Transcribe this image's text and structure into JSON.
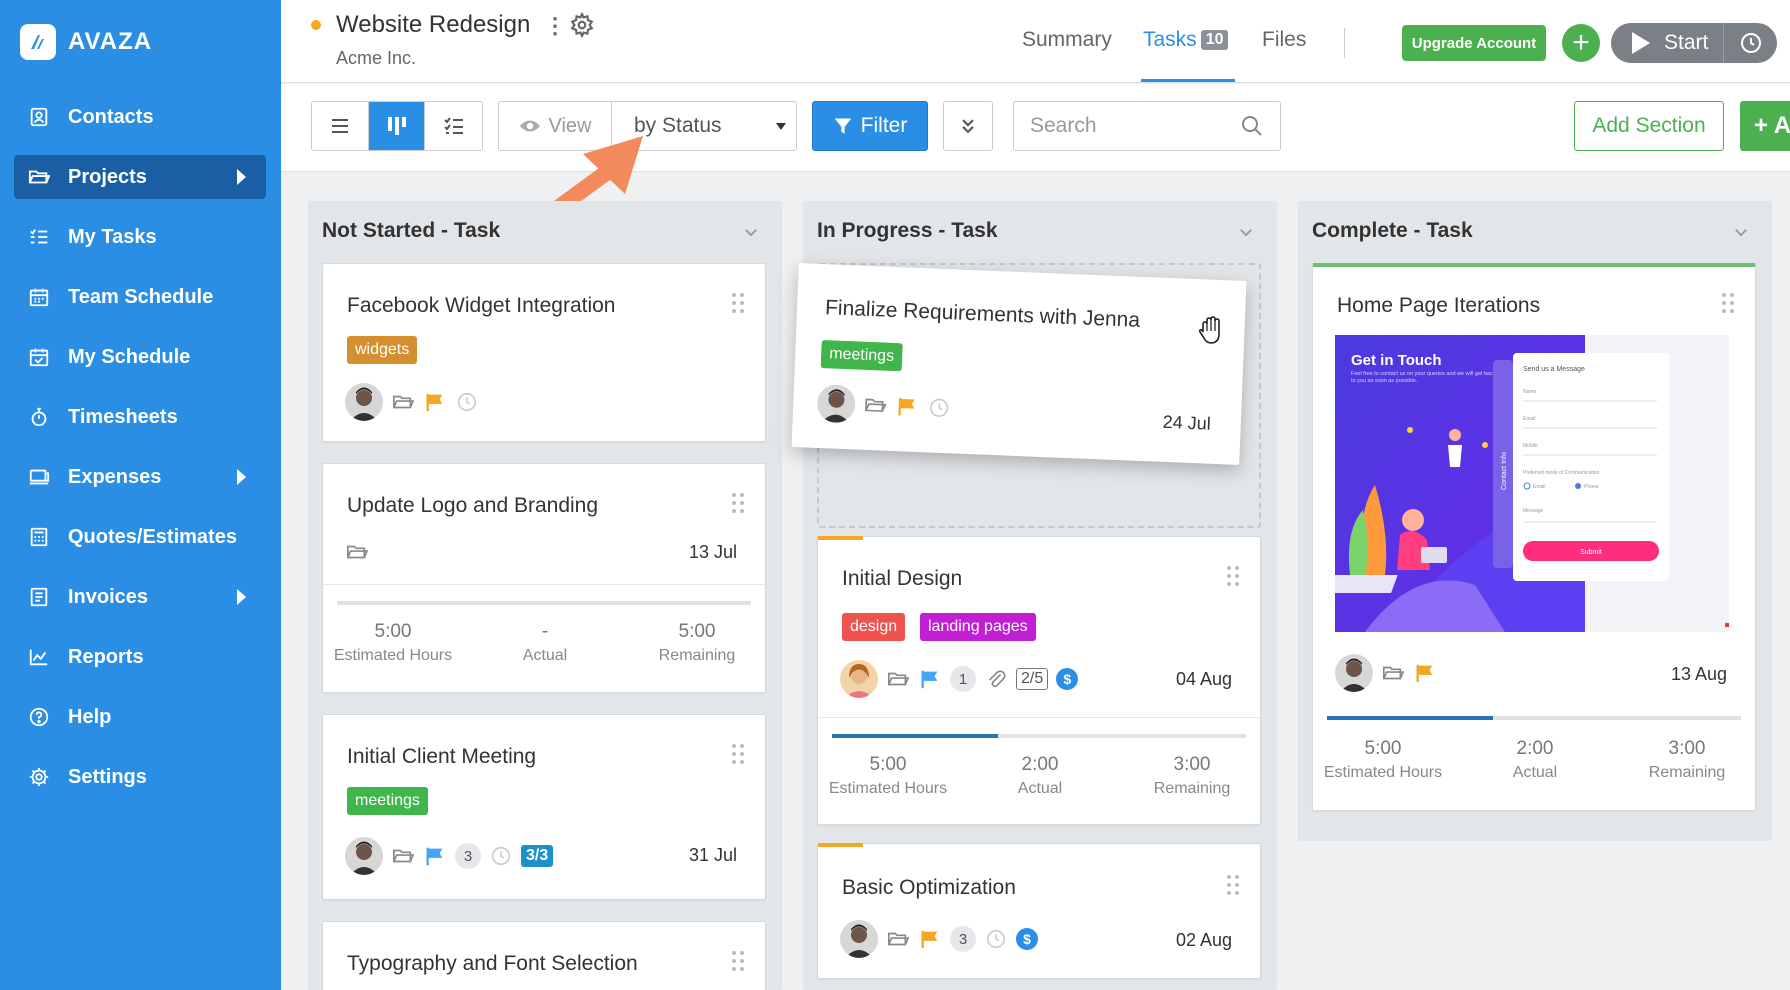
{
  "brand": {
    "name": "AVAZA",
    "logo_letter": "/"
  },
  "sidebar": {
    "items": [
      {
        "label": "Contacts",
        "icon": "contacts-icon"
      },
      {
        "label": "Projects",
        "icon": "folder-icon",
        "active": true,
        "arrow": true
      },
      {
        "label": "My Tasks",
        "icon": "tasks-icon"
      },
      {
        "label": "Team Schedule",
        "icon": "calendar-icon"
      },
      {
        "label": "My Schedule",
        "icon": "calendar-check-icon"
      },
      {
        "label": "Timesheets",
        "icon": "stopwatch-icon"
      },
      {
        "label": "Expenses",
        "icon": "expenses-icon",
        "arrow": true
      },
      {
        "label": "Quotes/Estimates",
        "icon": "calculator-icon"
      },
      {
        "label": "Invoices",
        "icon": "invoice-icon",
        "arrow": true
      },
      {
        "label": "Reports",
        "icon": "chart-icon"
      },
      {
        "label": "Help",
        "icon": "help-icon"
      },
      {
        "label": "Settings",
        "icon": "gear-icon"
      }
    ]
  },
  "header": {
    "project_title": "Website Redesign",
    "client": "Acme Inc.",
    "tabs": [
      {
        "label": "Summary"
      },
      {
        "label": "Tasks",
        "count": "10",
        "active": true
      },
      {
        "label": "Files"
      }
    ],
    "upgrade_label": "Upgrade Account",
    "start_label": "Start"
  },
  "toolbar": {
    "view_label": "View",
    "view_value": "by Status",
    "filter_label": "Filter",
    "search_placeholder": "Search",
    "add_section_label": "Add Section",
    "add_task_label": "+ A"
  },
  "colors": {
    "sidebar": "#2b8ee5",
    "sidebar_active": "#1a5fa4",
    "accent": "#2b8ee5",
    "green": "#4caf50",
    "tag_widgets": "#d4902e",
    "tag_meetings": "#3fb54a",
    "tag_design": "#ef5350",
    "tag_landing": "#c21fd4",
    "flag_orange": "#f5a623",
    "flag_blue": "#42a5f5",
    "arrow": "#f28a5c"
  },
  "columns": [
    {
      "title": "Not Started - Task",
      "cards": [
        {
          "title": "Facebook Widget Integration",
          "tag": "widgets"
        },
        {
          "title": "Update Logo and Branding",
          "due": "13 Jul",
          "estimated": "5:00",
          "actual": "-",
          "remaining": "5:00"
        },
        {
          "title": "Initial Client Meeting",
          "tag": "meetings",
          "comments": "3",
          "checklist": "3/3",
          "due": "31 Jul"
        },
        {
          "title": "Typography and Font Selection"
        }
      ]
    },
    {
      "title": "In Progress - Task",
      "dragged": {
        "title": "Finalize Requirements with Jenna",
        "tag": "meetings",
        "due": "24 Jul"
      },
      "cards": [
        {
          "title": "Initial Design",
          "tags": [
            "design",
            "landing pages"
          ],
          "comments": "1",
          "checklist": "2/5",
          "due": "04 Aug",
          "progress": 0.4,
          "estimated": "5:00",
          "actual": "2:00",
          "remaining": "3:00"
        },
        {
          "title": "Basic Optimization",
          "comments": "3",
          "due": "02 Aug"
        }
      ]
    },
    {
      "title": "Complete - Task",
      "cards": [
        {
          "title": "Home Page Iterations",
          "due": "13 Aug",
          "progress": 0.4,
          "estimated": "5:00",
          "actual": "2:00",
          "remaining": "3:00",
          "thumbnail": {
            "heading": "Get in Touch",
            "body": "Feel free to contact us on your queries and we will get back to you as soon as possible.",
            "side_label": "Contact Info",
            "form_title": "Send us a Message",
            "fields": [
              "Name",
              "Email",
              "Mobile"
            ],
            "pref_label": "Preferred mode of Communication",
            "options": [
              "Email",
              "Phone"
            ],
            "message_label": "Message",
            "submit": "Submit"
          }
        }
      ]
    }
  ],
  "stat_labels": {
    "estimated": "Estimated Hours",
    "actual": "Actual",
    "remaining": "Remaining"
  }
}
